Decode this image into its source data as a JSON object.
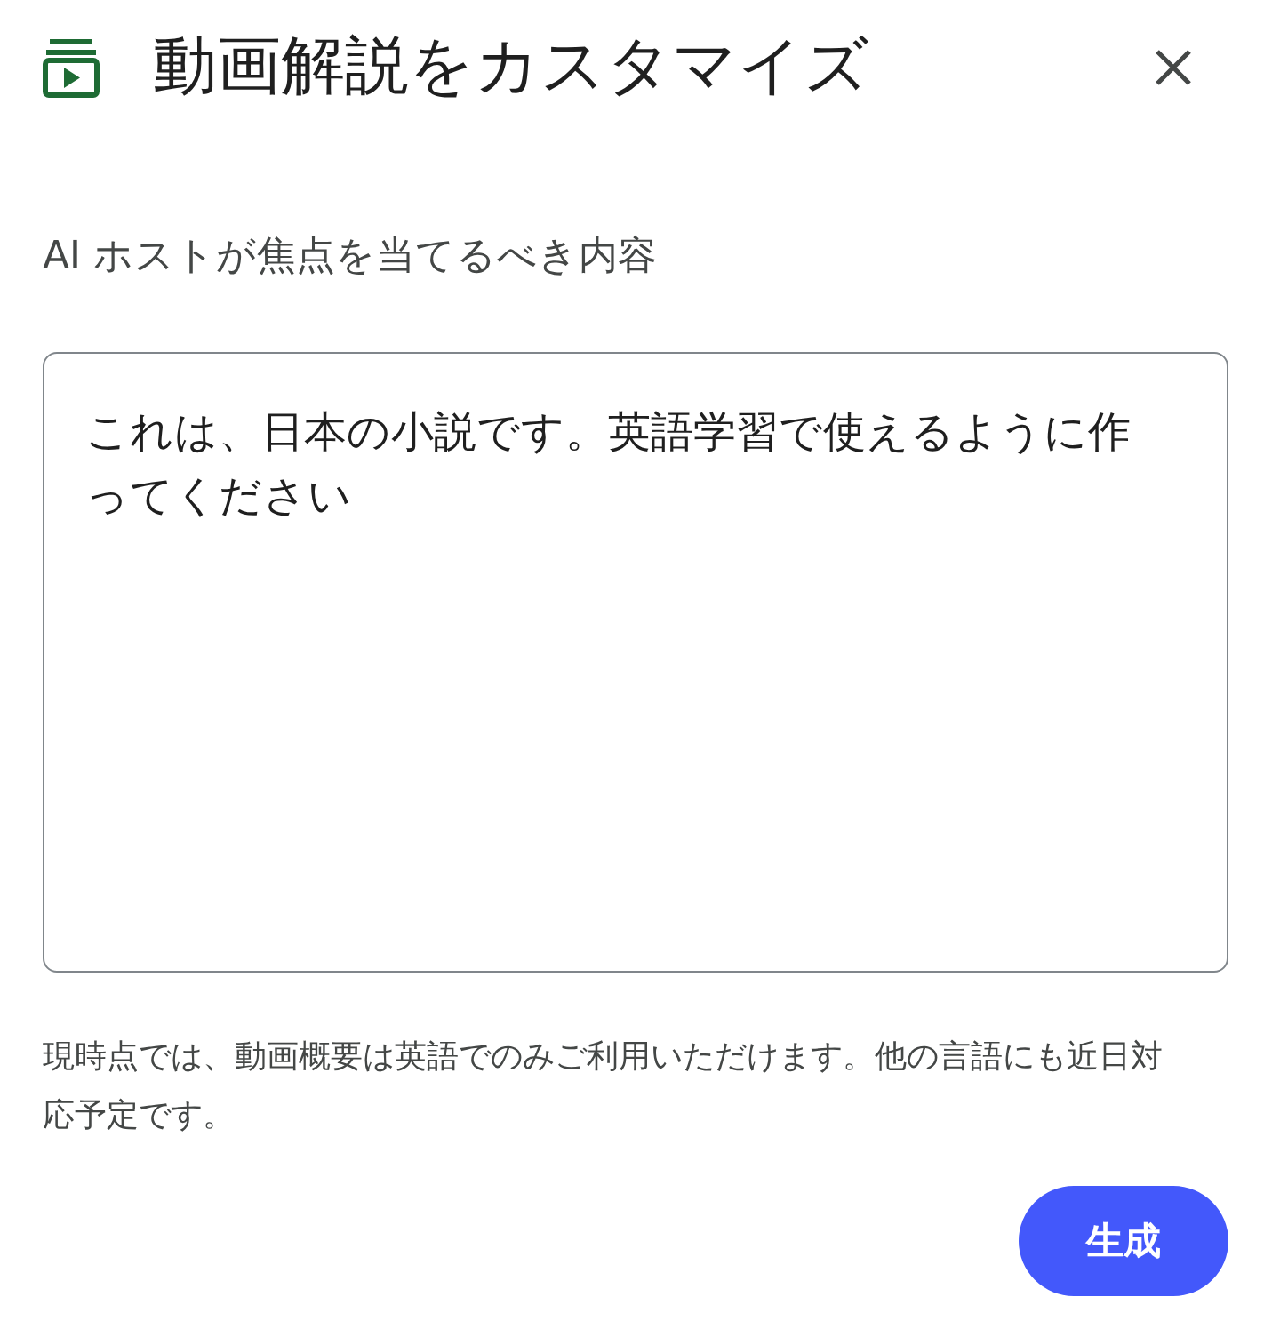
{
  "dialog": {
    "title": "動画解説をカスタマイズ"
  },
  "prompt": {
    "label": "AI ホストが焦点を当てるべき内容",
    "value": "これは、日本の小説です。英語学習で使えるように作ってください"
  },
  "notice": "現時点では、動画概要は英語でのみご利用いただけます。他の言語にも近日対応予定です。",
  "buttons": [
    "生成"
  ]
}
